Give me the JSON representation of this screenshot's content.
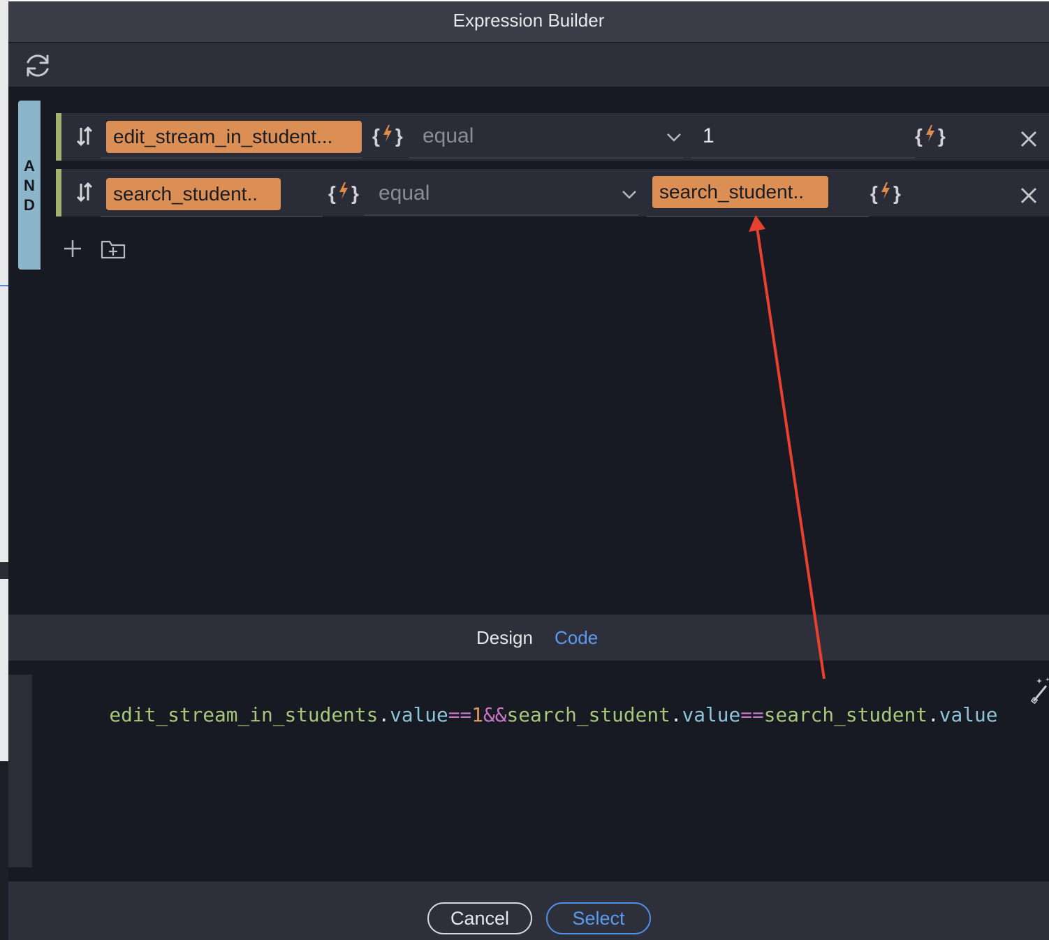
{
  "window": {
    "title": "Expression Builder"
  },
  "toolbar": {
    "refresh_icon": "refresh-icon"
  },
  "group": {
    "operator_letters": [
      "A",
      "N",
      "D"
    ]
  },
  "conditions": [
    {
      "left_chip": "edit_stream_in_student...",
      "dynamic_icon": "{ϟ}",
      "operator": "equal",
      "right_value": "1",
      "right_dynamic_icon": "{ϟ}"
    },
    {
      "left_chip": "search_student..",
      "dynamic_icon": "{ϟ}",
      "operator": "equal",
      "right_chip": "search_student..",
      "right_dynamic_icon": "{ϟ}"
    }
  ],
  "tabs": {
    "design": "Design",
    "code": "Code",
    "active": "Code"
  },
  "code": {
    "tokens": [
      {
        "t": "edit_stream_in_students",
        "k": "id"
      },
      {
        "t": ".",
        "k": "dot"
      },
      {
        "t": "value",
        "k": "prop"
      },
      {
        "t": "==",
        "k": "op"
      },
      {
        "t": "1",
        "k": "num"
      },
      {
        "t": "&&",
        "k": "op"
      },
      {
        "t": "search_student",
        "k": "id"
      },
      {
        "t": ".",
        "k": "dot"
      },
      {
        "t": "value",
        "k": "prop"
      },
      {
        "t": "==",
        "k": "op"
      },
      {
        "t": "search_student",
        "k": "id"
      },
      {
        "t": ".",
        "k": "dot"
      },
      {
        "t": "value",
        "k": "prop"
      }
    ]
  },
  "footer": {
    "cancel_label": "Cancel",
    "select_label": "Select"
  },
  "colors": {
    "chip": "#db8f54",
    "accent_blue": "#5b9cf0",
    "annotation_arrow": "#e8412f",
    "group_bar": "#8db5c9"
  }
}
